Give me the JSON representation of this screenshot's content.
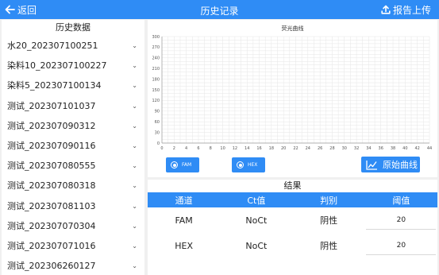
{
  "header": {
    "back_label": "返回",
    "title": "历史记录",
    "upload_label": "报告上传"
  },
  "sidebar": {
    "title": "历史数据",
    "items": [
      {
        "label": "水20_202307100251"
      },
      {
        "label": "染料10_202307100227"
      },
      {
        "label": "染料5_202307100134"
      },
      {
        "label": "测试_202307101037"
      },
      {
        "label": "测试_202307090312"
      },
      {
        "label": "测试_202307090116"
      },
      {
        "label": "测试_202307080555"
      },
      {
        "label": "测试_202307080318"
      },
      {
        "label": "测试_202307081103"
      },
      {
        "label": "测试_202307070304"
      },
      {
        "label": "测试_202307071016"
      },
      {
        "label": "测试_202306260127"
      }
    ]
  },
  "chart_data": {
    "type": "line",
    "title": "荧光曲线",
    "xlabel": "",
    "ylabel": "",
    "xlim": [
      0,
      44
    ],
    "ylim": [
      0,
      300
    ],
    "x_ticks": [
      "0",
      "2",
      "4",
      "6",
      "8",
      "10",
      "12",
      "14",
      "16",
      "18",
      "20",
      "22",
      "24",
      "26",
      "28",
      "30",
      "32",
      "34",
      "36",
      "38",
      "40",
      "42",
      "44"
    ],
    "y_ticks": [
      "0",
      "30",
      "60",
      "90",
      "120",
      "150",
      "180",
      "210",
      "240",
      "270",
      "300"
    ],
    "grid": true,
    "series": []
  },
  "channel_buttons": {
    "fam_label": "FAM",
    "hex_label": "HEX"
  },
  "raw_curve_label": "原始曲线",
  "results": {
    "title": "结果",
    "columns": [
      "通道",
      "Ct值",
      "判别",
      "阈值"
    ],
    "rows": [
      {
        "channel": "FAM",
        "ct": "NoCt",
        "verdict": "阴性",
        "threshold": "20"
      },
      {
        "channel": "HEX",
        "ct": "NoCt",
        "verdict": "阴性",
        "threshold": "20"
      }
    ]
  },
  "colors": {
    "accent": "#2f8cf5",
    "background": "#f0f0f0",
    "grid": "#e6e6e6"
  }
}
